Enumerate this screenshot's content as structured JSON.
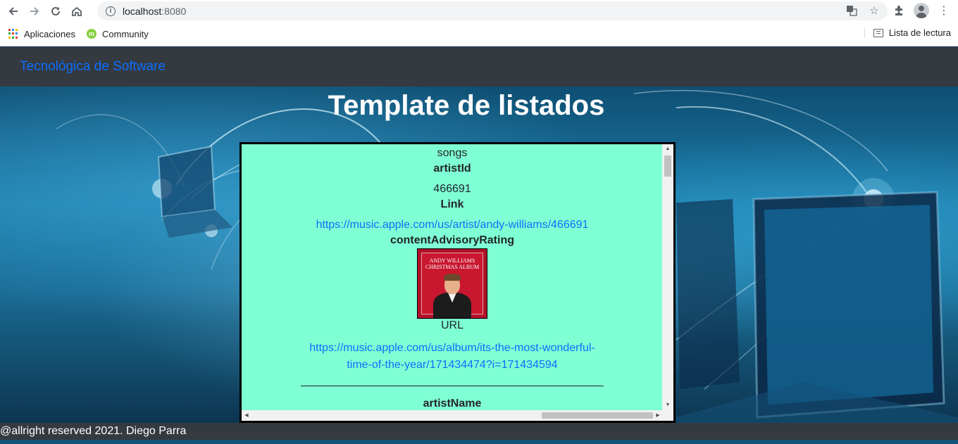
{
  "browser": {
    "url_host": "localhost",
    "url_port": ":8080",
    "bookmarks": [
      {
        "label": "Aplicaciones"
      },
      {
        "label": "Community"
      }
    ],
    "reading_list_label": "Lista de lectura"
  },
  "navbar": {
    "brand": "Tecnológica de Software"
  },
  "page": {
    "title": "Template de listados"
  },
  "record": {
    "section": "songs",
    "artist_id_label": "artistId",
    "artist_id_value": "466691",
    "link_label": "Link",
    "link_value": "https://music.apple.com/us/artist/andy-williams/466691",
    "rating_label": "contentAdvisoryRating",
    "album_art_text": "ANDY WILLIAMS CHRISTMAS ALBUM",
    "url_label": "URL",
    "url_value_line1": "https://music.apple.com/us/album/its-the-most-wonderful-",
    "url_value_line2": "time-of-the-year/171434474?i=171434594",
    "next_label": "artistName"
  },
  "footer": {
    "text": "@allright reserved 2021. Diego Parra"
  },
  "colors": {
    "navbar_bg": "#343a40",
    "brand": "#0d6efd",
    "panel_bg": "#7fffd4",
    "link": "#0d6efd"
  }
}
